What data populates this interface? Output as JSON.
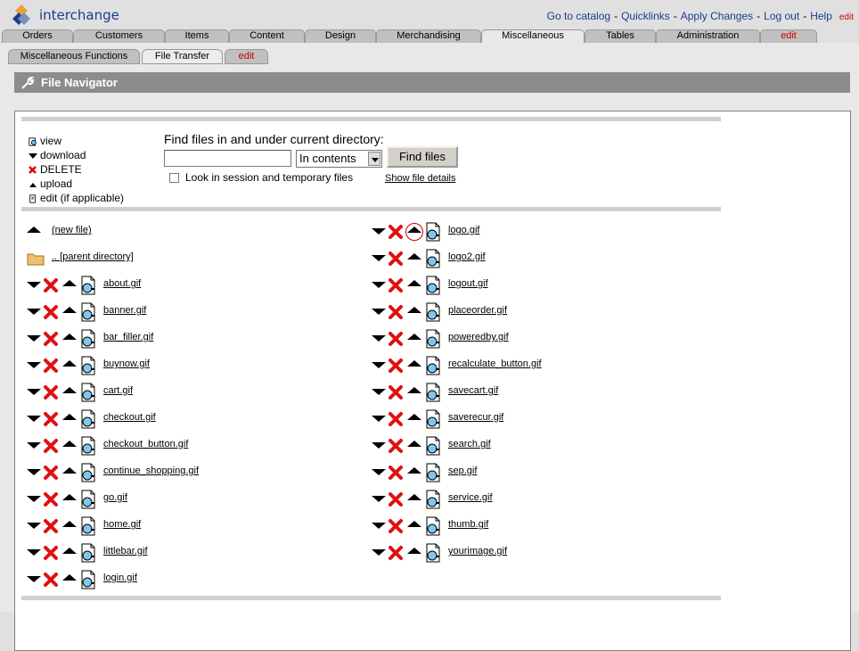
{
  "app": {
    "name": "interchange"
  },
  "toplinks": [
    {
      "label": "Go to catalog"
    },
    {
      "label": "Quicklinks"
    },
    {
      "label": "Apply Changes"
    },
    {
      "label": "Log out"
    },
    {
      "label": "Help"
    }
  ],
  "toplinks_edit": "edit",
  "tabs": [
    "Orders",
    "Customers",
    "Items",
    "Content",
    "Design",
    "Merchandising",
    "Miscellaneous",
    "Tables",
    "Administration",
    "edit"
  ],
  "active_tab": "Miscellaneous",
  "subtabs": [
    "Miscellaneous Functions",
    "File Transfer",
    "edit"
  ],
  "active_subtab": "File Transfer",
  "panel": {
    "title": "File Navigator"
  },
  "legend": {
    "view": "view",
    "download": "download",
    "delete": "DELETE",
    "upload": "upload",
    "edit": "edit (if applicable)"
  },
  "find": {
    "label": "Find files in and under current directory:",
    "input_value": "",
    "select_value": "In contents",
    "button": "Find files",
    "checkbox_label": "Look in session and temporary files",
    "show_details": "Show file details"
  },
  "files_left": [
    "about.gif",
    "banner.gif",
    "bar_filler.gif",
    "buynow.gif",
    "cart.gif",
    "checkout.gif",
    "checkout_button.gif",
    "continue_shopping.gif",
    "go.gif",
    "home.gif",
    "littlebar.gif",
    "login.gif"
  ],
  "files_right": [
    "logo.gif",
    "logo2.gif",
    "logout.gif",
    "placeorder.gif",
    "poweredby.gif",
    "recalculate_button.gif",
    "savecart.gif",
    "saverecur.gif",
    "search.gif",
    "sep.gif",
    "service.gif",
    "thumb.gif",
    "yourimage.gif"
  ],
  "new_file": "(new file)",
  "parent_dir": ".. [parent directory]",
  "colors": {
    "accent": "#1a3d8f",
    "red": "#cc0000",
    "header_bar": "#8c8c8c"
  }
}
